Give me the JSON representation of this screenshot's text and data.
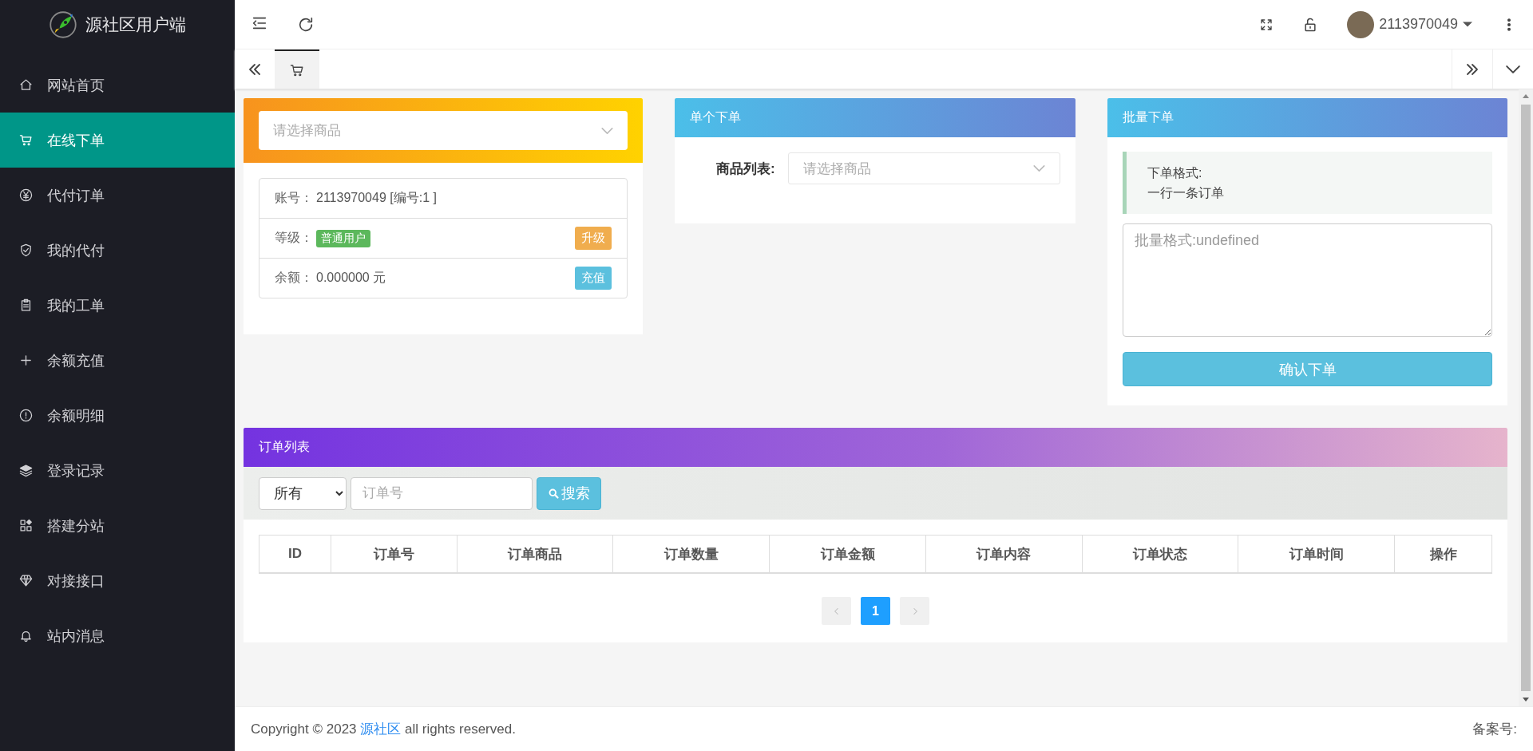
{
  "sidebar": {
    "brand": "源社区用户端",
    "items": [
      {
        "label": "网站首页",
        "selected": false
      },
      {
        "label": "在线下单",
        "selected": true
      },
      {
        "label": "代付订单",
        "selected": false
      },
      {
        "label": "我的代付",
        "selected": false
      },
      {
        "label": "我的工单",
        "selected": false
      },
      {
        "label": "余额充值",
        "selected": false
      },
      {
        "label": "余额明细",
        "selected": false
      },
      {
        "label": "登录记录",
        "selected": false
      },
      {
        "label": "搭建分站",
        "selected": false
      },
      {
        "label": "对接接口",
        "selected": false
      },
      {
        "label": "站内消息",
        "selected": false
      }
    ]
  },
  "topbar": {
    "username": "2113970049"
  },
  "tabs": [
    {
      "selected": true
    }
  ],
  "product_card": {
    "select_placeholder": "请选择商品",
    "account_label": "账号：",
    "account_value": "2113970049 [编号:1 ]",
    "level_label": "等级：",
    "level_badge": "普通用户",
    "upgrade_button": "升级",
    "balance_label": "余额：",
    "balance_value": "0.000000 元",
    "recharge_button": "充值"
  },
  "single_order": {
    "title": "单个下单",
    "field_label": "商品列表:",
    "select_placeholder": "请选择商品"
  },
  "batch_order": {
    "title": "批量下单",
    "format_title": "下单格式:",
    "format_text": "一行一条订单",
    "textarea_placeholder": "批量格式:undefined",
    "submit_button": "确认下单"
  },
  "order_list": {
    "title": "订单列表",
    "filter_value": "所有",
    "search_placeholder": "订单号",
    "search_button": "搜索",
    "columns": [
      "ID",
      "订单号",
      "订单商品",
      "订单数量",
      "订单金额",
      "订单内容",
      "订单状态",
      "订单时间",
      "操作"
    ],
    "pages": [
      {
        "label": "1",
        "selected": true
      }
    ]
  },
  "footer": {
    "copyright": "Copyright © 2023",
    "link": "源社区",
    "suffix": "all rights reserved.",
    "record": "备案号:"
  }
}
